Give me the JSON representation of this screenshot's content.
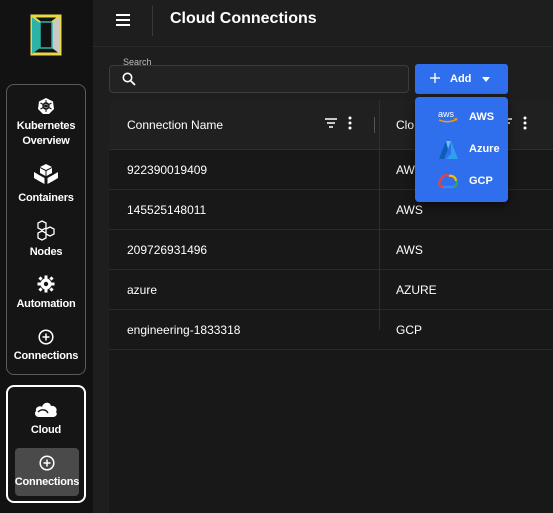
{
  "header": {
    "title": "Cloud Connections"
  },
  "sidebar": {
    "group1": [
      {
        "label": "Kubernetes Overview",
        "line1": "Kubernetes",
        "line2": "Overview",
        "icon": "kubernetes-icon"
      },
      {
        "label": "Containers",
        "icon": "containers-icon"
      },
      {
        "label": "Nodes",
        "icon": "nodes-icon"
      },
      {
        "label": "Automation",
        "icon": "gear-icon"
      },
      {
        "label": "Connections",
        "icon": "plus-circle-icon"
      }
    ],
    "group2": [
      {
        "label": "Cloud",
        "icon": "cloud-icon"
      },
      {
        "label": "Connections",
        "icon": "plus-circle-icon",
        "active": true
      }
    ]
  },
  "search": {
    "label": "Search",
    "value": "",
    "placeholder": ""
  },
  "add_button": {
    "label": "Add"
  },
  "add_menu": [
    {
      "label": "AWS",
      "icon": "aws-icon"
    },
    {
      "label": "Azure",
      "icon": "azure-icon"
    },
    {
      "label": "GCP",
      "icon": "gcp-icon"
    }
  ],
  "table": {
    "columns": [
      "Connection Name",
      "Clo"
    ],
    "rows": [
      {
        "name": "922390019409",
        "cloud": "AWS"
      },
      {
        "name": "145525148011",
        "cloud": "AWS"
      },
      {
        "name": "209726931496",
        "cloud": "AWS"
      },
      {
        "name": "azure",
        "cloud": "AZURE"
      },
      {
        "name": "engineering-1833318",
        "cloud": "GCP"
      }
    ]
  },
  "colors": {
    "accent": "#2f6fed",
    "background": "#1e1e1e",
    "sidebar": "#121212"
  }
}
